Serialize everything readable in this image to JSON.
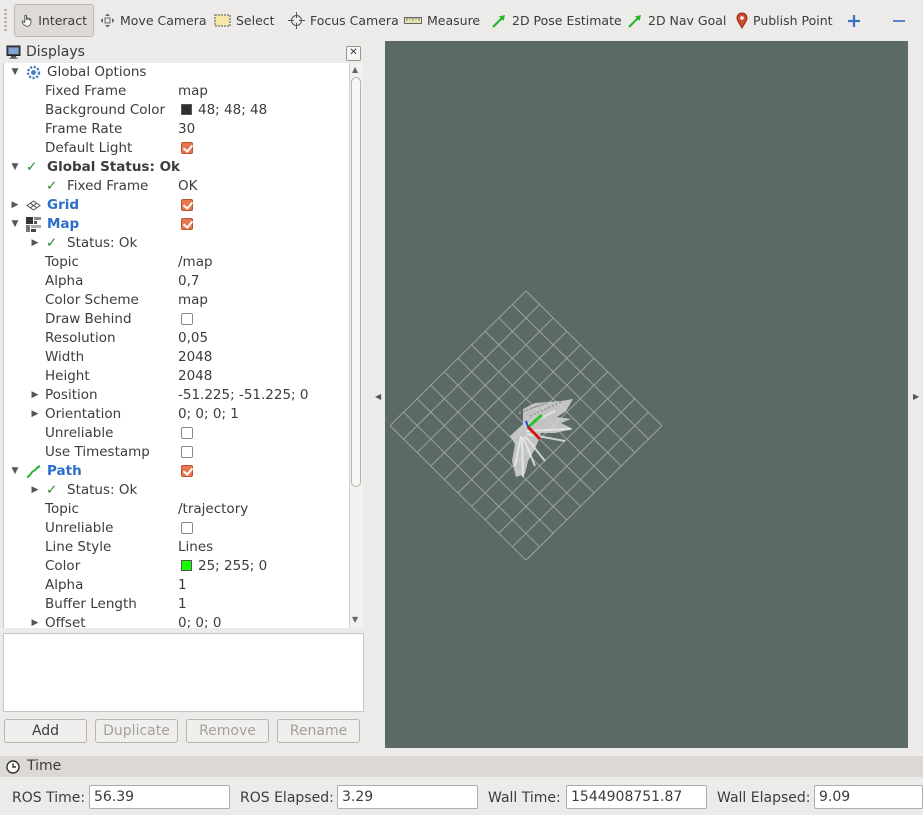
{
  "toolbar": {
    "tools": [
      {
        "label": "Interact",
        "icon": "hand-pointer-icon",
        "active": true
      },
      {
        "label": "Move Camera",
        "icon": "move-camera-icon"
      },
      {
        "label": "Select",
        "icon": "select-box-icon"
      },
      {
        "label": "Focus Camera",
        "icon": "crosshair-icon"
      },
      {
        "label": "Measure",
        "icon": "ruler-icon"
      },
      {
        "label": "2D Pose Estimate",
        "icon": "green-arrow-icon"
      },
      {
        "label": "2D Nav Goal",
        "icon": "green-arrow-icon"
      },
      {
        "label": "Publish Point",
        "icon": "map-pin-icon"
      }
    ],
    "add_icon": "plus-icon",
    "remove_icon": "minus-icon"
  },
  "displays": {
    "title": "Displays",
    "rows": [
      {
        "label": "Global Options",
        "value": ""
      },
      {
        "label": "Fixed Frame",
        "value": "map"
      },
      {
        "label": "Background Color",
        "value": "48; 48; 48",
        "swatch": "#303030"
      },
      {
        "label": "Frame Rate",
        "value": "30"
      },
      {
        "label": "Default Light",
        "checked": true
      },
      {
        "label": "Global Status: Ok",
        "value": ""
      },
      {
        "label": "Fixed Frame",
        "value": "OK"
      },
      {
        "label": "Grid",
        "checked": true
      },
      {
        "label": "Map",
        "checked": true
      },
      {
        "label": "Status: Ok",
        "value": ""
      },
      {
        "label": "Topic",
        "value": "/map"
      },
      {
        "label": "Alpha",
        "value": "0,7"
      },
      {
        "label": "Color Scheme",
        "value": "map"
      },
      {
        "label": "Draw Behind",
        "checked": false
      },
      {
        "label": "Resolution",
        "value": "0,05"
      },
      {
        "label": "Width",
        "value": "2048"
      },
      {
        "label": "Height",
        "value": "2048"
      },
      {
        "label": "Position",
        "value": "-51.225; -51.225; 0"
      },
      {
        "label": "Orientation",
        "value": "0; 0; 0; 1"
      },
      {
        "label": "Unreliable",
        "checked": false
      },
      {
        "label": "Use Timestamp",
        "checked": false
      },
      {
        "label": "Path",
        "checked": true
      },
      {
        "label": "Status: Ok",
        "value": ""
      },
      {
        "label": "Topic",
        "value": "/trajectory"
      },
      {
        "label": "Unreliable",
        "checked": false
      },
      {
        "label": "Line Style",
        "value": "Lines"
      },
      {
        "label": "Color",
        "value": "25; 255; 0",
        "swatch": "#19ff00"
      },
      {
        "label": "Alpha",
        "value": "1"
      },
      {
        "label": "Buffer Length",
        "value": "1"
      },
      {
        "label": "Offset",
        "value": "0; 0; 0"
      }
    ],
    "buttons": {
      "add": "Add",
      "duplicate": "Duplicate",
      "remove": "Remove",
      "rename": "Rename"
    }
  },
  "viewport": {
    "background": "#5b6967",
    "grid_color": "#a0a0a0",
    "axis_colors": {
      "x": "#d11515",
      "y": "#2fbf2f"
    }
  },
  "time": {
    "title": "Time",
    "ros_time_label": "ROS Time:",
    "ros_time": "56.39",
    "ros_elapsed_label": "ROS Elapsed:",
    "ros_elapsed": "3.29",
    "wall_time_label": "Wall Time:",
    "wall_time": "1544908751.87",
    "wall_elapsed_label": "Wall Elapsed:",
    "wall_elapsed": "9.09"
  }
}
